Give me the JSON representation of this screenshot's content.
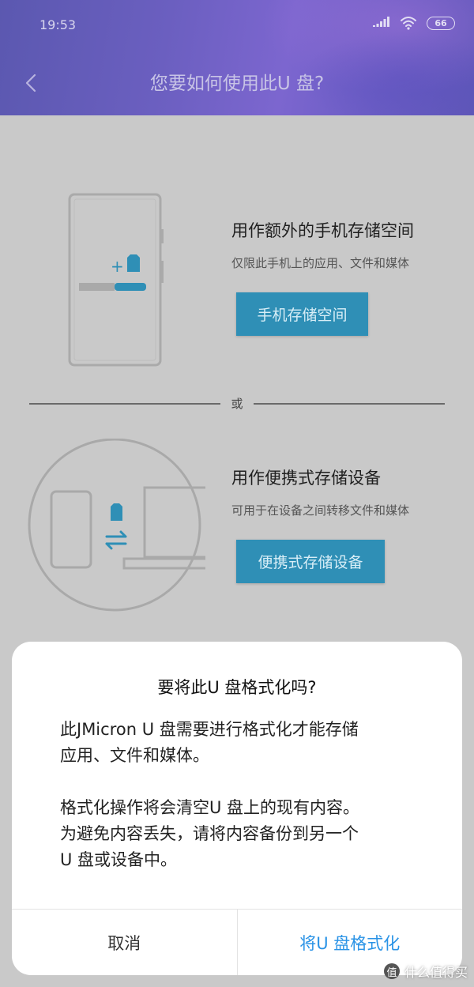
{
  "status_bar": {
    "time": "19:53",
    "battery": "66"
  },
  "header": {
    "title": "您要如何使用此U 盘?"
  },
  "option_internal": {
    "title": "用作额外的手机存储空间",
    "subtitle": "仅限此手机上的应用、文件和媒体",
    "button_label": "手机存储空间"
  },
  "divider": {
    "label": "或"
  },
  "option_portable": {
    "title": "用作便携式存储设备",
    "subtitle": "可用于在设备之间转移文件和媒体",
    "button_label": "便携式存储设备"
  },
  "dialog": {
    "title": "要将此U 盘格式化吗?",
    "paragraph_1": "此JMicron U 盘需要进行格式化才能存储\n应用、文件和媒体。",
    "paragraph_2": "格式化操作将会清空U 盘上的现有内容。\n为避免内容丢失，请将内容备份到另一个\nU 盘或设备中。",
    "cancel_label": "取消",
    "confirm_label": "将U 盘格式化"
  },
  "watermark": {
    "logo": "值",
    "text": "什么值得买"
  },
  "colors": {
    "accent_button": "#2f8fb6",
    "dialog_confirm": "#2a93e6",
    "header": "#6b5fc0"
  }
}
